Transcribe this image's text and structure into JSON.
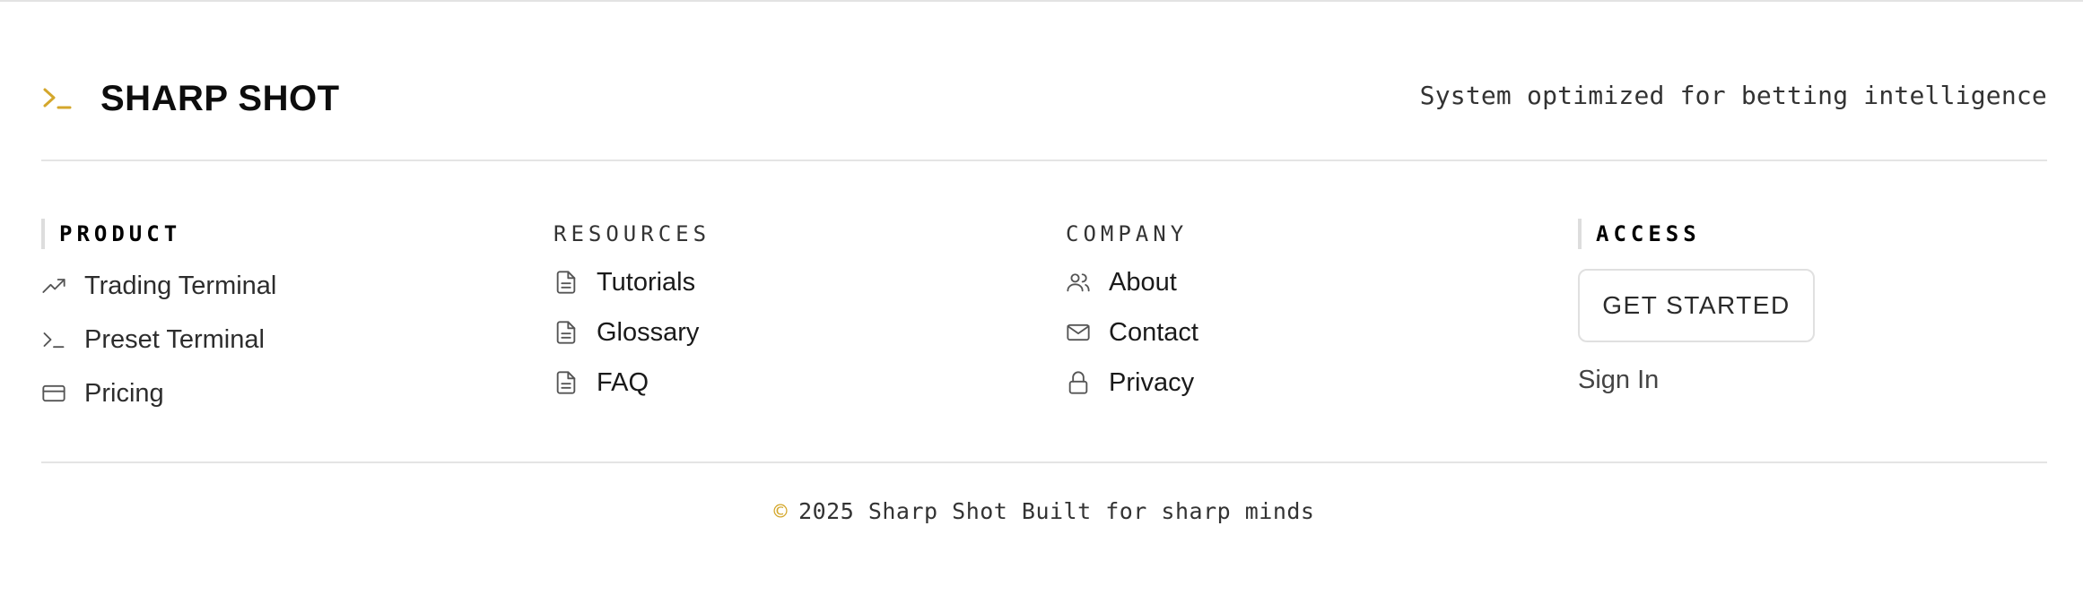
{
  "brand": {
    "name": "SHARP SHOT",
    "icon": "terminal-prompt-icon",
    "accent_color": "#d4a72c"
  },
  "tagline": "System optimized for betting intelligence",
  "columns": {
    "product": {
      "heading": "PRODUCT",
      "items": [
        {
          "label": "Trading Terminal",
          "icon": "trending-up-icon"
        },
        {
          "label": "Preset Terminal",
          "icon": "terminal-icon"
        },
        {
          "label": "Pricing",
          "icon": "credit-card-icon"
        }
      ]
    },
    "resources": {
      "heading": "RESOURCES",
      "items": [
        {
          "label": "Tutorials",
          "icon": "document-icon"
        },
        {
          "label": "Glossary",
          "icon": "document-icon"
        },
        {
          "label": "FAQ",
          "icon": "document-icon"
        }
      ]
    },
    "company": {
      "heading": "COMPANY",
      "items": [
        {
          "label": "About",
          "icon": "users-icon"
        },
        {
          "label": "Contact",
          "icon": "mail-icon"
        },
        {
          "label": "Privacy",
          "icon": "lock-icon"
        }
      ]
    },
    "access": {
      "heading": "ACCESS",
      "get_started_label": "GET STARTED",
      "sign_in_label": "Sign In"
    }
  },
  "footer": {
    "copyright_symbol": "©",
    "copyright_text": "2025 Sharp Shot Built for sharp minds"
  }
}
